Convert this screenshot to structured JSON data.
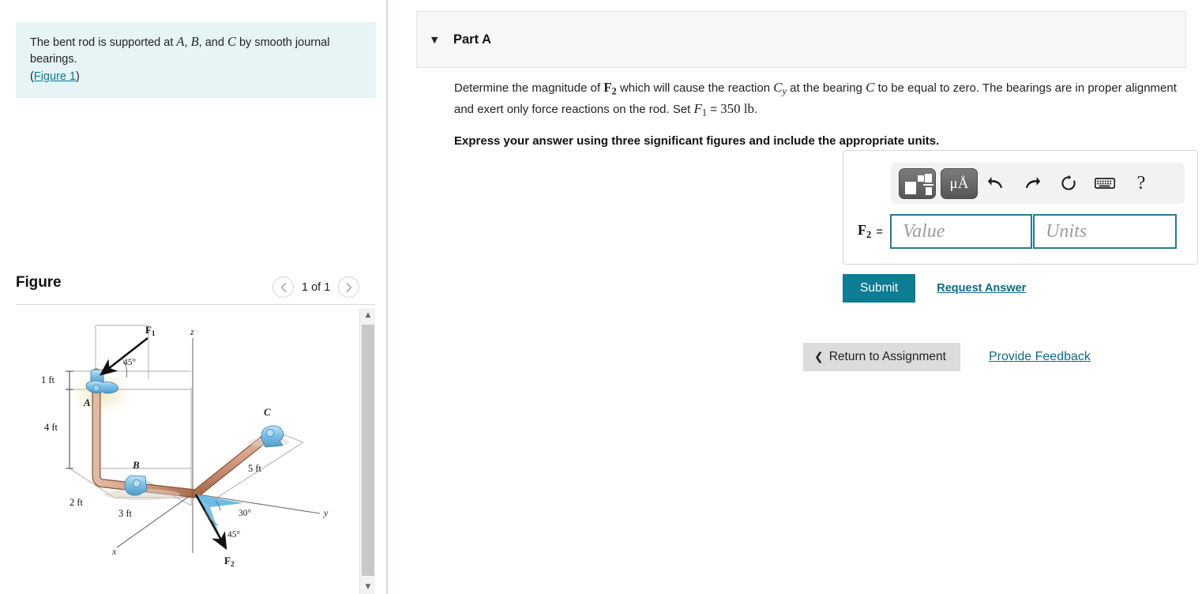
{
  "problem": {
    "statement_prefix": "The bent rod is supported at ",
    "statement_a": "A",
    "comma1": ", ",
    "statement_b": "B",
    "comma2": ", and ",
    "statement_c": "C",
    "statement_suffix": " by smooth journal bearings.",
    "figure_link": "Figure 1",
    "paren_open": "(",
    "paren_close": ")"
  },
  "figure_panel": {
    "title": "Figure",
    "counter": "1 of 1",
    "prev_icon": "chevron-left-icon",
    "next_icon": "chevron-right-icon",
    "scroll_up_icon": "triangle-up-icon",
    "scroll_down_icon": "triangle-down-icon"
  },
  "figure_diagram": {
    "force_labels": [
      "F",
      "F"
    ],
    "label_F1": "F",
    "label_F1_sub": "1",
    "label_F2": "F",
    "label_F2_sub": "2",
    "bearing_A": "A",
    "bearing_B": "B",
    "bearing_C": "C",
    "axis_x": "x",
    "axis_y": "y",
    "axis_z": "z",
    "dim_1ft": "1 ft",
    "dim_4ft": "4 ft",
    "dim_2ft": "2 ft",
    "dim_3ft": "3 ft",
    "dim_5ft": "5 ft",
    "angle_45_top": "45°",
    "angle_30": "30°",
    "angle_45_bottom": "45°",
    "colors": {
      "rod": "#c89274",
      "bearing": "#7fc3e8",
      "shade": "#59b4e0",
      "guide": "#9a9a9a"
    }
  },
  "part": {
    "header_title": "Part A",
    "collapse_icon": "caret-down-icon",
    "question": {
      "t1": "Determine the magnitude of ",
      "F2": "F",
      "F2sub": "2",
      "t2": " which will cause the reaction ",
      "C": "C",
      "Csub": "y",
      "t3": " at the bearing ",
      "C2": "C",
      "t4": " to be equal to zero. The bearings are in proper alignment and exert only force reactions on the rod. Set ",
      "F1": "F",
      "F1sub": "1",
      "t5": " = ",
      "val": "350",
      "units": "lb",
      "t6": "."
    },
    "instruction": "Express your answer using three significant figures and include the appropriate units."
  },
  "answer_widget": {
    "toolbar": {
      "template_icon": "math-template-icon",
      "units_icon_label": "μÅ",
      "undo_icon": "undo-arrow-icon",
      "redo_icon": "redo-arrow-icon",
      "reset_icon": "reset-circular-arrow-icon",
      "keyboard_icon": "keyboard-icon",
      "help_icon": "question-mark-icon",
      "help_label": "?"
    },
    "var_label": "F",
    "var_sub": "2",
    "equals": "=",
    "value_placeholder": "Value",
    "units_placeholder": "Units",
    "value_current": "",
    "units_current": ""
  },
  "actions": {
    "submit_label": "Submit",
    "request_answer_label": "Request Answer",
    "return_label": "Return to Assignment",
    "return_caret": "❮",
    "provide_feedback_label": "Provide Feedback"
  },
  "colors": {
    "accent_teal": "#0d7c95",
    "link_teal": "#0b6c86",
    "info_bg": "#e6f4f5",
    "header_bg": "#f7f7f7",
    "input_border": "#277c8e"
  }
}
